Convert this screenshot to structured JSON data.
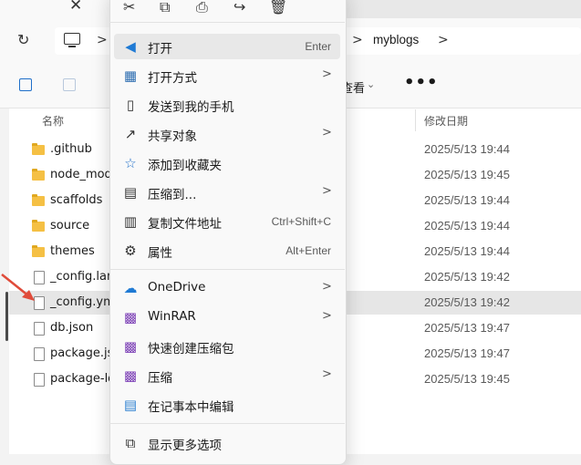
{
  "window": {
    "tab_close": "✕",
    "breadcrumb": ">",
    "current_folder": "myblogs"
  },
  "toolbar": {
    "view_label": "查看",
    "more_label": "•••"
  },
  "columns": {
    "name": "名称",
    "modified": "修改日期"
  },
  "files": [
    {
      "name": ".github",
      "type": "folder",
      "date": "2025/5/13 19:44"
    },
    {
      "name": "node_modu",
      "type": "folder",
      "date": "2025/5/13 19:45"
    },
    {
      "name": "scaffolds",
      "type": "folder",
      "date": "2025/5/13 19:44"
    },
    {
      "name": "source",
      "type": "folder",
      "date": "2025/5/13 19:44"
    },
    {
      "name": "themes",
      "type": "folder",
      "date": "2025/5/13 19:44"
    },
    {
      "name": "_config.land",
      "type": "file",
      "date": "2025/5/13 19:42"
    },
    {
      "name": "_config.yml",
      "type": "file",
      "date": "2025/5/13 19:42",
      "selected": true
    },
    {
      "name": "db.json",
      "type": "file",
      "date": "2025/5/13 19:47"
    },
    {
      "name": "package.jso",
      "type": "file",
      "date": "2025/5/13 19:47"
    },
    {
      "name": "package-lo",
      "type": "file",
      "date": "2025/5/13 19:45"
    }
  ],
  "context_menu": {
    "items": [
      {
        "label": "打开",
        "shortcut": "Enter",
        "icon": "vscode-icon"
      },
      {
        "label": "打开方式",
        "submenu": true,
        "icon": "open-with-icon"
      },
      {
        "label": "发送到我的手机",
        "icon": "phone-icon"
      },
      {
        "label": "共享对象",
        "submenu": true,
        "icon": "share-icon"
      },
      {
        "label": "添加到收藏夹",
        "icon": "star-icon"
      },
      {
        "label": "压缩到...",
        "submenu": true,
        "icon": "zip-icon"
      },
      {
        "label": "复制文件地址",
        "shortcut": "Ctrl+Shift+C",
        "icon": "copy-path-icon"
      },
      {
        "label": "属性",
        "shortcut": "Alt+Enter",
        "icon": "wrench-icon"
      },
      {
        "label": "OneDrive",
        "submenu": true,
        "icon": "onedrive-icon"
      },
      {
        "label": "WinRAR",
        "submenu": true,
        "icon": "winrar-icon"
      },
      {
        "label": "快速创建压缩包",
        "icon": "winrar-icon"
      },
      {
        "label": "压缩",
        "submenu": true,
        "icon": "winrar-icon"
      },
      {
        "label": "在记事本中编辑",
        "icon": "notepad-icon"
      },
      {
        "label": "显示更多选项",
        "icon": "more-options-icon"
      }
    ],
    "submenu_glyph": ">"
  },
  "colors": {
    "selection": "#cce0f5",
    "accent": "#1f6fc9",
    "arrow": "#e04b3a"
  }
}
